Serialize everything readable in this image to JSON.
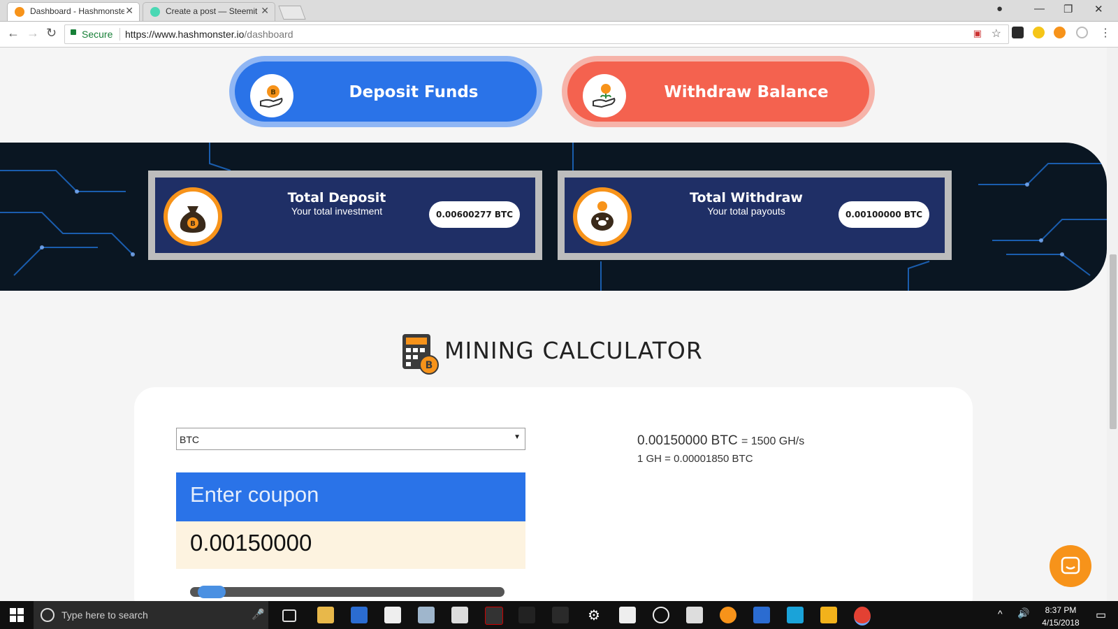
{
  "browser": {
    "tabs": [
      {
        "title": "Dashboard - Hashmonster",
        "active": true
      },
      {
        "title": "Create a post — Steemit",
        "active": false
      }
    ],
    "secure_label": "Secure",
    "url_host": "https://www.hashmonster.io",
    "url_path": "/dashboard"
  },
  "actions": {
    "deposit_label": "Deposit Funds",
    "withdraw_label": "Withdraw Balance"
  },
  "stats": {
    "deposit": {
      "title": "Total Deposit",
      "subtitle": "Your total investment",
      "value": "0.00600277 BTC"
    },
    "withdraw": {
      "title": "Total Withdraw",
      "subtitle": "Your total payouts",
      "value": "0.00100000 BTC"
    }
  },
  "calculator": {
    "title": "MINING CALCULATOR",
    "currency_selected": "BTC",
    "coupon_placeholder": "Enter coupon",
    "amount": "0.00150000",
    "rate_btc": "0.00150000 BTC",
    "rate_eq": "= 1500 GH/s",
    "rate_unit": "1 GH = 0.00001850 BTC",
    "slider_fraction": 0.05
  },
  "taskbar": {
    "search_placeholder": "Type here to search",
    "time": "8:37 PM",
    "date": "4/15/2018"
  },
  "colors": {
    "deposit": "#2a73e8",
    "withdraw": "#f4624f",
    "bitcoin": "#f7931a",
    "card": "#1f2f66"
  }
}
